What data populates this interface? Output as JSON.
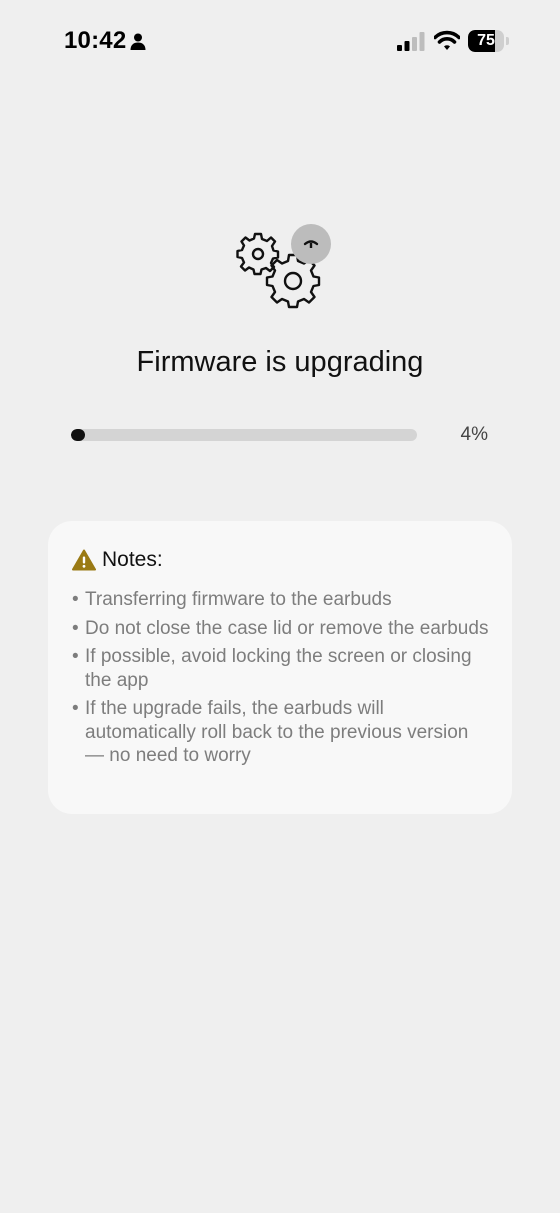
{
  "status_bar": {
    "time": "10:42",
    "battery_level": "75",
    "battery_fraction": 0.75,
    "icons": [
      "person-icon",
      "cellular-signal-icon",
      "wifi-icon",
      "battery-icon"
    ]
  },
  "upgrade": {
    "icon": "gears-icon",
    "title": "Firmware is upgrading",
    "progress_fraction": 0.04,
    "progress_label": "4%"
  },
  "notes": {
    "icon": "warning-icon",
    "title": "Notes:",
    "items": [
      {
        "bullet": "•",
        "text": "Transferring firmware to the earbuds"
      },
      {
        "bullet": "•",
        "text": "Do not close the case lid or remove the earbuds"
      },
      {
        "bullet": "•",
        "text": "If possible, avoid locking the screen or closing the app"
      },
      {
        "bullet": "•",
        "text": "If the upgrade fails, the earbuds will automatically roll back to the previous version — no need to worry"
      }
    ]
  },
  "colors": {
    "background": "#efefef",
    "card": "#f8f8f8",
    "warning": "#9a7a14",
    "progress_track": "#d4d4d4",
    "progress_fill": "#111111",
    "note_text": "#7d7d7d"
  }
}
